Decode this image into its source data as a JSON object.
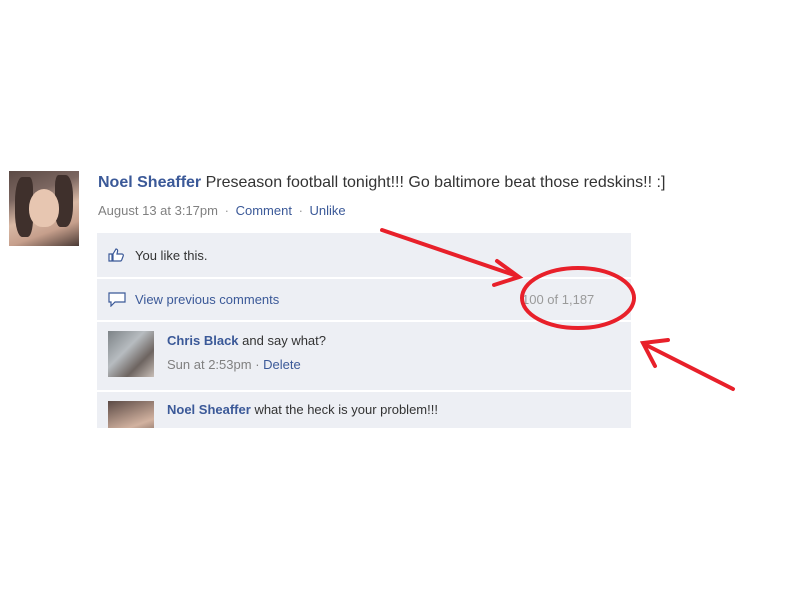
{
  "post": {
    "author": "Noel Sheaffer",
    "text": "Preseason football tonight!!! Go baltimore beat those redskins!! :]",
    "timestamp": "August 13 at 3:17pm",
    "comment_label": "Comment",
    "unlike_label": "Unlike",
    "separator": "·"
  },
  "ufi": {
    "likes_text": "You like this.",
    "view_previous_label": "View previous comments",
    "comment_count": "100 of 1,187",
    "comments": [
      {
        "author": "Chris Black",
        "text": "and say what?",
        "timestamp": "Sun at 2:53pm",
        "delete_label": "Delete"
      },
      {
        "author": "Noel Sheaffer",
        "text": "what the heck is your problem!!!"
      }
    ]
  },
  "annotations": {
    "color": "#e8202a"
  },
  "colors": {
    "link": "#3b5998",
    "ufi_background": "#edeff4",
    "muted_text": "#808080"
  }
}
